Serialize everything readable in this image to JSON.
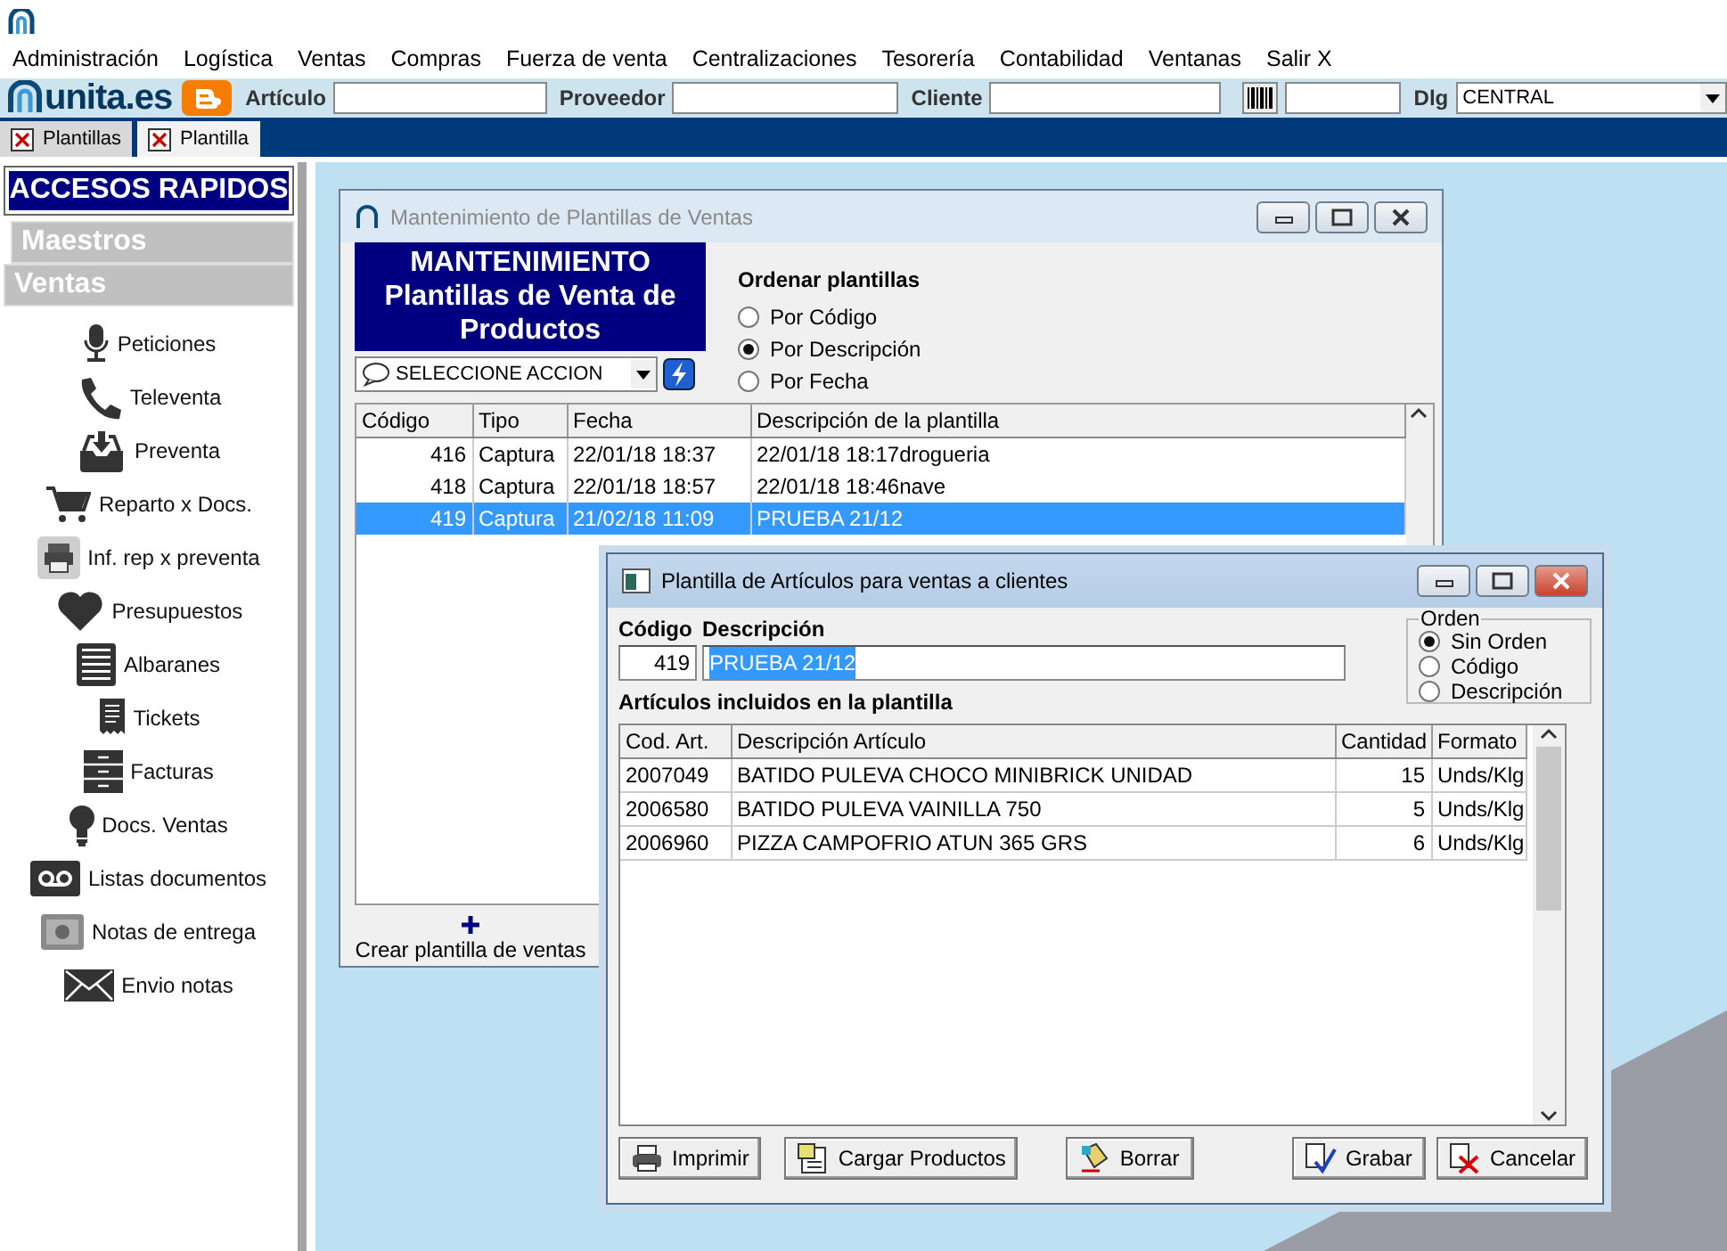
{
  "menu": [
    "Administración",
    "Logística",
    "Ventas",
    "Compras",
    "Fuerza de venta",
    "Centralizaciones",
    "Tesorería",
    "Contabilidad",
    "Ventanas",
    "Salir X"
  ],
  "toolbar": {
    "logo": "unita.es",
    "fields": [
      {
        "label": "Artículo"
      },
      {
        "label": "Proveedor"
      },
      {
        "label": "Cliente"
      }
    ],
    "dlg_label": "Dlg",
    "dlg_value": "CENTRAL"
  },
  "tabs": [
    {
      "label": "Plantillas",
      "selected": false
    },
    {
      "label": "Plantilla",
      "selected": true
    }
  ],
  "sidebar": {
    "title": "ACCESOS RAPIDOS",
    "sections": [
      {
        "label": "Maestros",
        "expanded": false
      },
      {
        "label": "Ventas",
        "expanded": true,
        "items": [
          "Peticiones",
          "Televenta",
          "Preventa",
          "Reparto x Docs.",
          "Inf. rep x preventa",
          "Presupuestos",
          "Albaranes",
          "Tickets",
          "Facturas",
          "Docs. Ventas",
          "Listas documentos",
          "Notas de entrega",
          "Envio notas"
        ]
      }
    ]
  },
  "main_window": {
    "title": "Mantenimiento de Plantillas de Ventas",
    "active": false,
    "header_lines": [
      "MANTENIMIENTO",
      "Plantillas de Venta de Productos"
    ],
    "action": "SELECCIONE ACCION",
    "sort": {
      "title": "Ordenar plantillas",
      "options": [
        {
          "label": "Por Código",
          "selected": false
        },
        {
          "label": "Por Descripción",
          "selected": true
        },
        {
          "label": "Por Fecha",
          "selected": false
        }
      ]
    },
    "table": {
      "columns": [
        "Código",
        "Tipo",
        "Fecha",
        "Descripción de la plantilla"
      ],
      "rows": [
        {
          "cells": [
            "416",
            "Captura",
            "22/01/18 18:37",
            "22/01/18 18:17drogueria"
          ],
          "selected": false
        },
        {
          "cells": [
            "418",
            "Captura",
            "22/01/18 18:57",
            "22/01/18 18:46nave"
          ],
          "selected": false
        },
        {
          "cells": [
            "419",
            "Captura",
            "21/02/18 11:09",
            "PRUEBA 21/12"
          ],
          "selected": true
        }
      ]
    },
    "create_label": "Crear plantilla de ventas"
  },
  "detail_window": {
    "title": "Plantilla de Artículos para ventas a clientes",
    "active": true,
    "code_label": "Código",
    "description_label": "Descripción",
    "code": "419",
    "description": "PRUEBA 21/12",
    "order": {
      "title": "Orden",
      "options": [
        {
          "label": "Sin Orden",
          "selected": true
        },
        {
          "label": "Código",
          "selected": false
        },
        {
          "label": "Descripción",
          "selected": false
        }
      ]
    },
    "list_title": "Artículos incluidos en la plantilla",
    "table": {
      "columns": [
        "Cod. Art.",
        "Descripción Artículo",
        "Cantidad",
        "Formato"
      ],
      "rows": [
        [
          "2007049",
          "BATIDO PULEVA CHOCO MINIBRICK UNIDAD",
          "15",
          "Unds/Klg"
        ],
        [
          "2006580",
          "BATIDO PULEVA VAINILLA 750",
          "5",
          "Unds/Klg"
        ],
        [
          "2006960",
          "PIZZA CAMPOFRIO ATUN 365 GRS",
          "6",
          "Unds/Klg"
        ]
      ]
    },
    "buttons": [
      "Imprimir",
      "Cargar Productos",
      "Borrar",
      "Grabar",
      "Cancelar"
    ]
  }
}
